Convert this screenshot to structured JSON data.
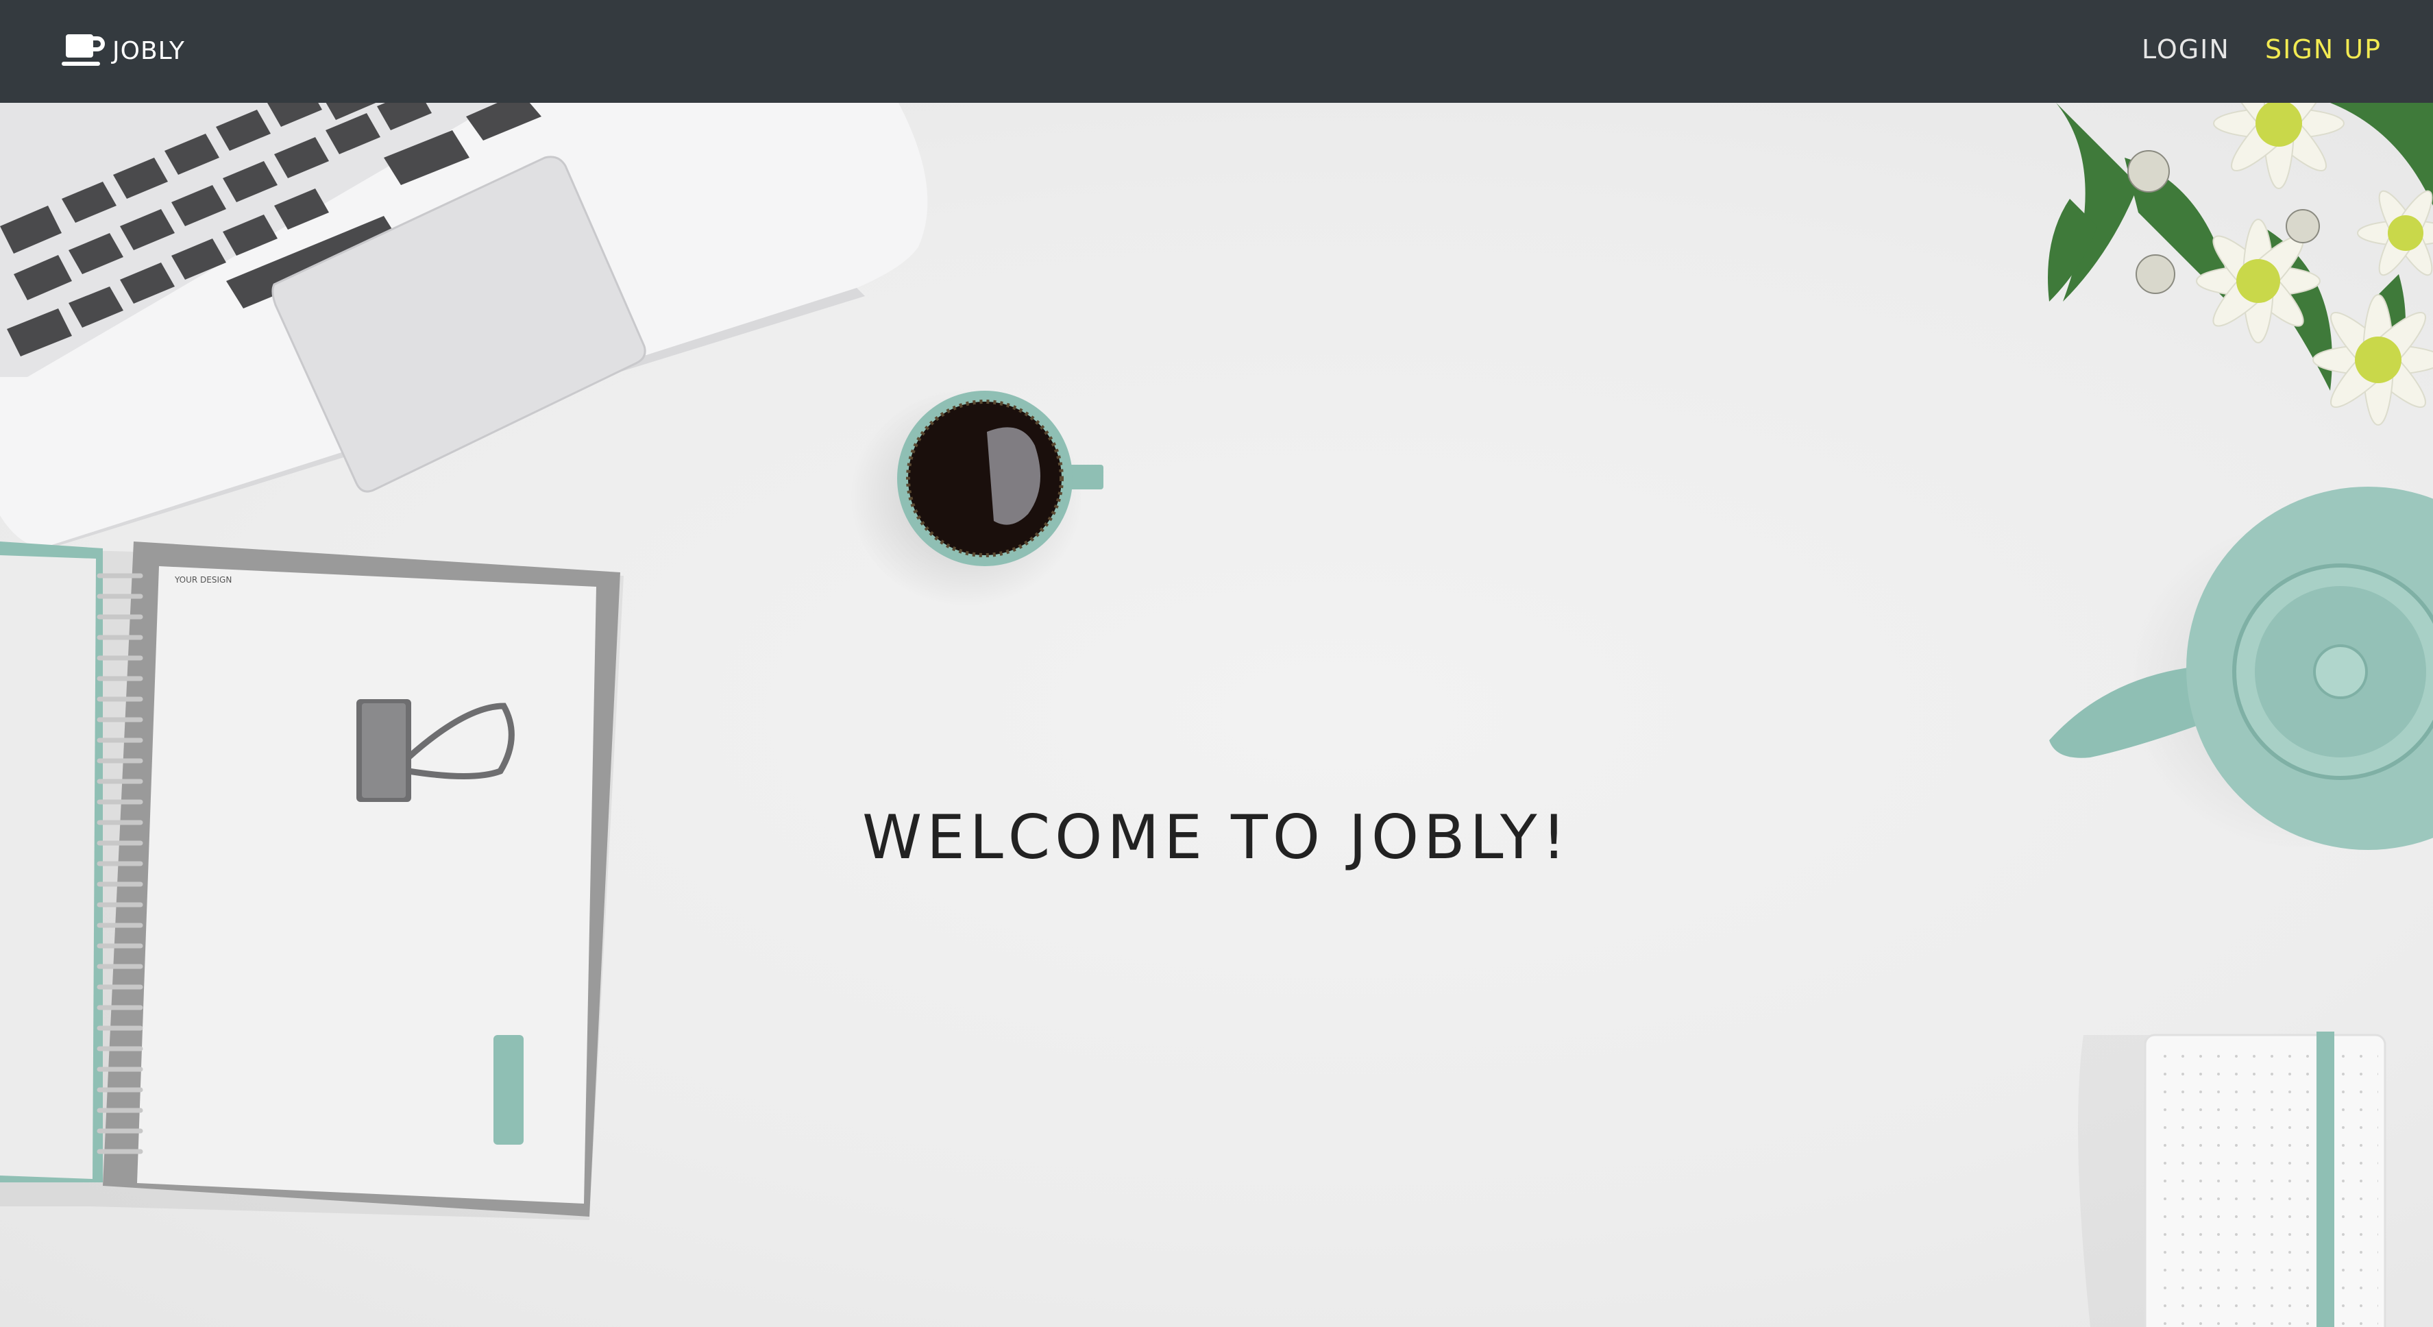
{
  "navbar": {
    "brand": {
      "icon": "coffee-cup-icon",
      "label": "JOBLY"
    },
    "links": [
      {
        "label": "LOGIN",
        "color": "#e6e6e6"
      },
      {
        "label": "SIGN UP",
        "color": "#f2ea52"
      }
    ]
  },
  "hero": {
    "title": "WELCOME TO JOBLY!",
    "notebook_text": "YOUR DESIGN"
  },
  "colors": {
    "navbar_bg": "#343a3f",
    "accent_teal": "#8fbfb4",
    "title": "#222222"
  }
}
